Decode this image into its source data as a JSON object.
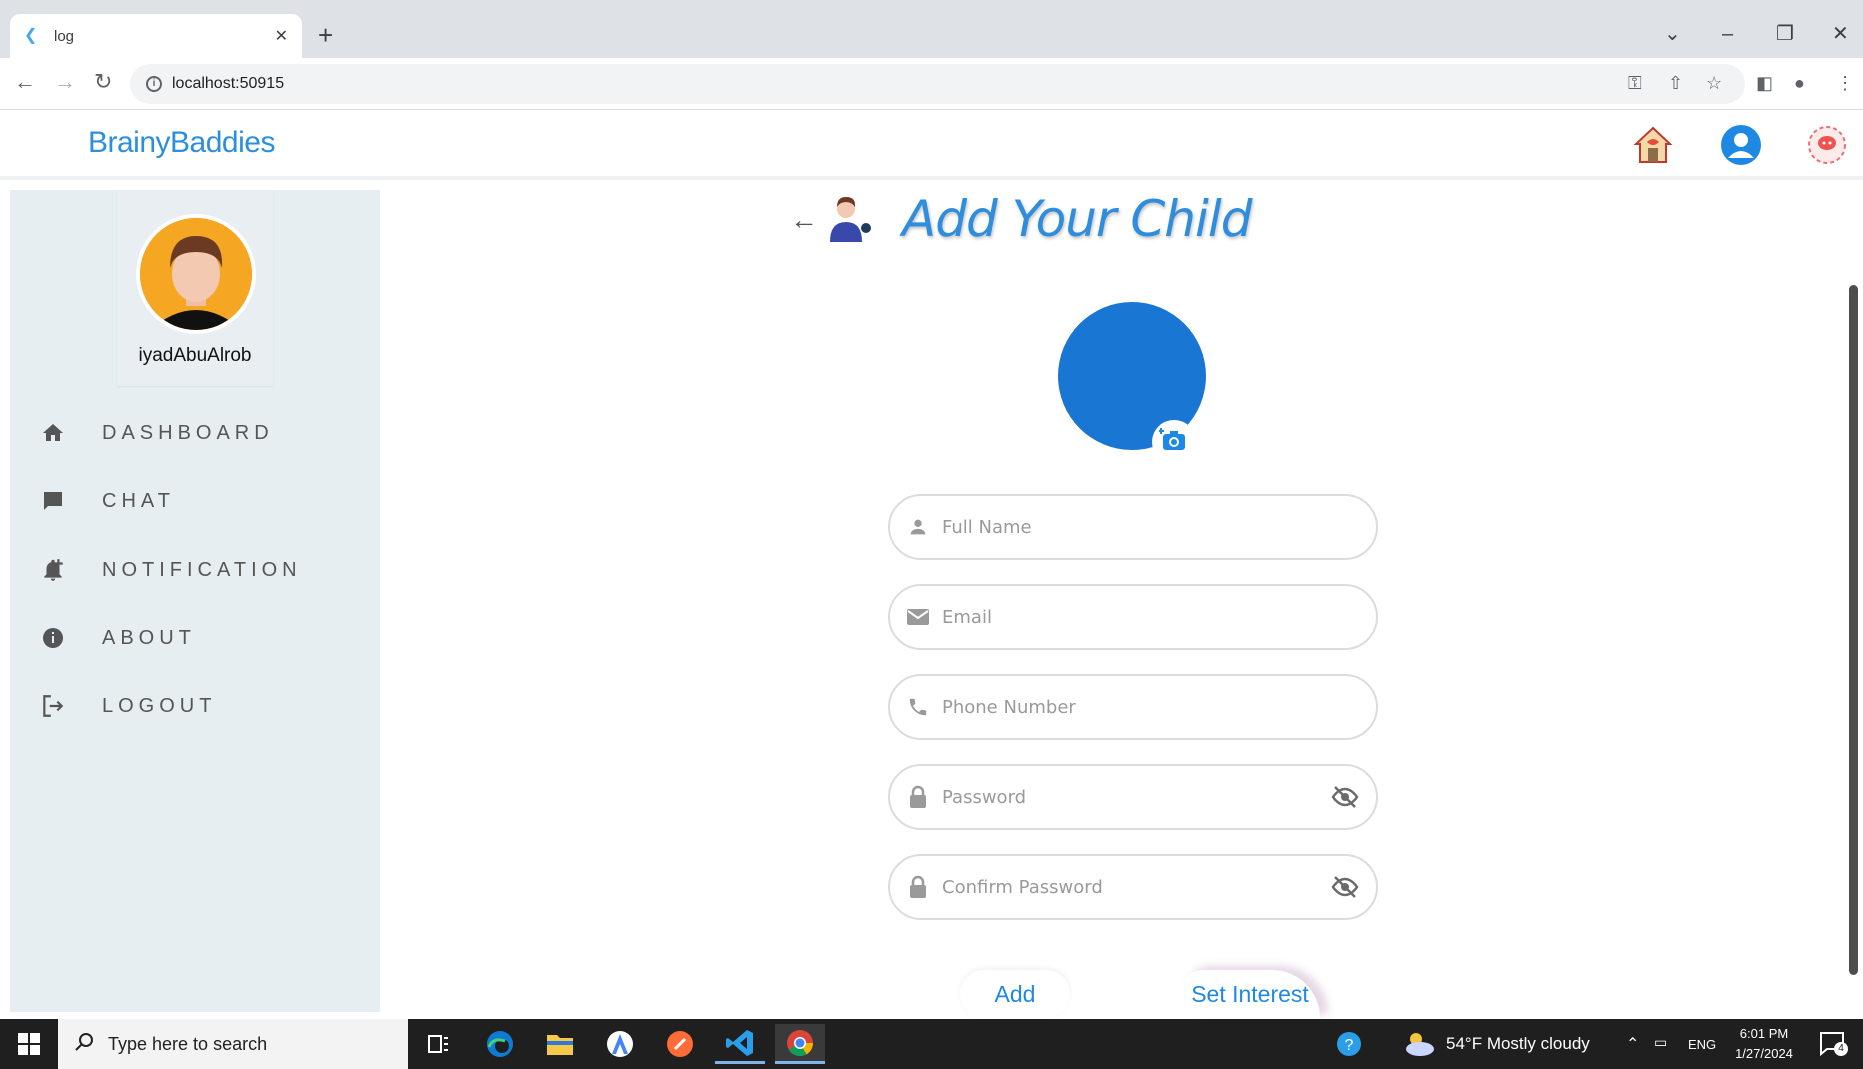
{
  "browser": {
    "tab_title": "log",
    "url": "localhost:50915"
  },
  "app": {
    "brand": "BrainyBaddies"
  },
  "sidebar": {
    "username": "iyadAbuAlrob",
    "items": [
      {
        "label": "DASHBOARD",
        "icon": "home-icon"
      },
      {
        "label": "CHAT",
        "icon": "chat-icon"
      },
      {
        "label": "NOTIFICATION",
        "icon": "notification-add-icon"
      },
      {
        "label": "ABOUT",
        "icon": "info-icon"
      },
      {
        "label": "LOGOUT",
        "icon": "logout-icon"
      }
    ]
  },
  "main": {
    "title": "Add Your Child",
    "fields": {
      "full_name": "Full Name",
      "email": "Email",
      "phone": "Phone Number",
      "password": "Password",
      "confirm_password": "Confirm Password"
    },
    "add_label": "Add",
    "interest_label": "Set Interest"
  },
  "taskbar": {
    "search_placeholder": "Type here to search",
    "weather": "54°F  Mostly cloudy",
    "lang": "ENG",
    "time": "6:01 PM",
    "date": "1/27/2024",
    "notif_count": "4"
  },
  "colors": {
    "accent": "#1976d2",
    "brand": "#2b8fdc",
    "sidebar_bg": "#e6eef1"
  }
}
